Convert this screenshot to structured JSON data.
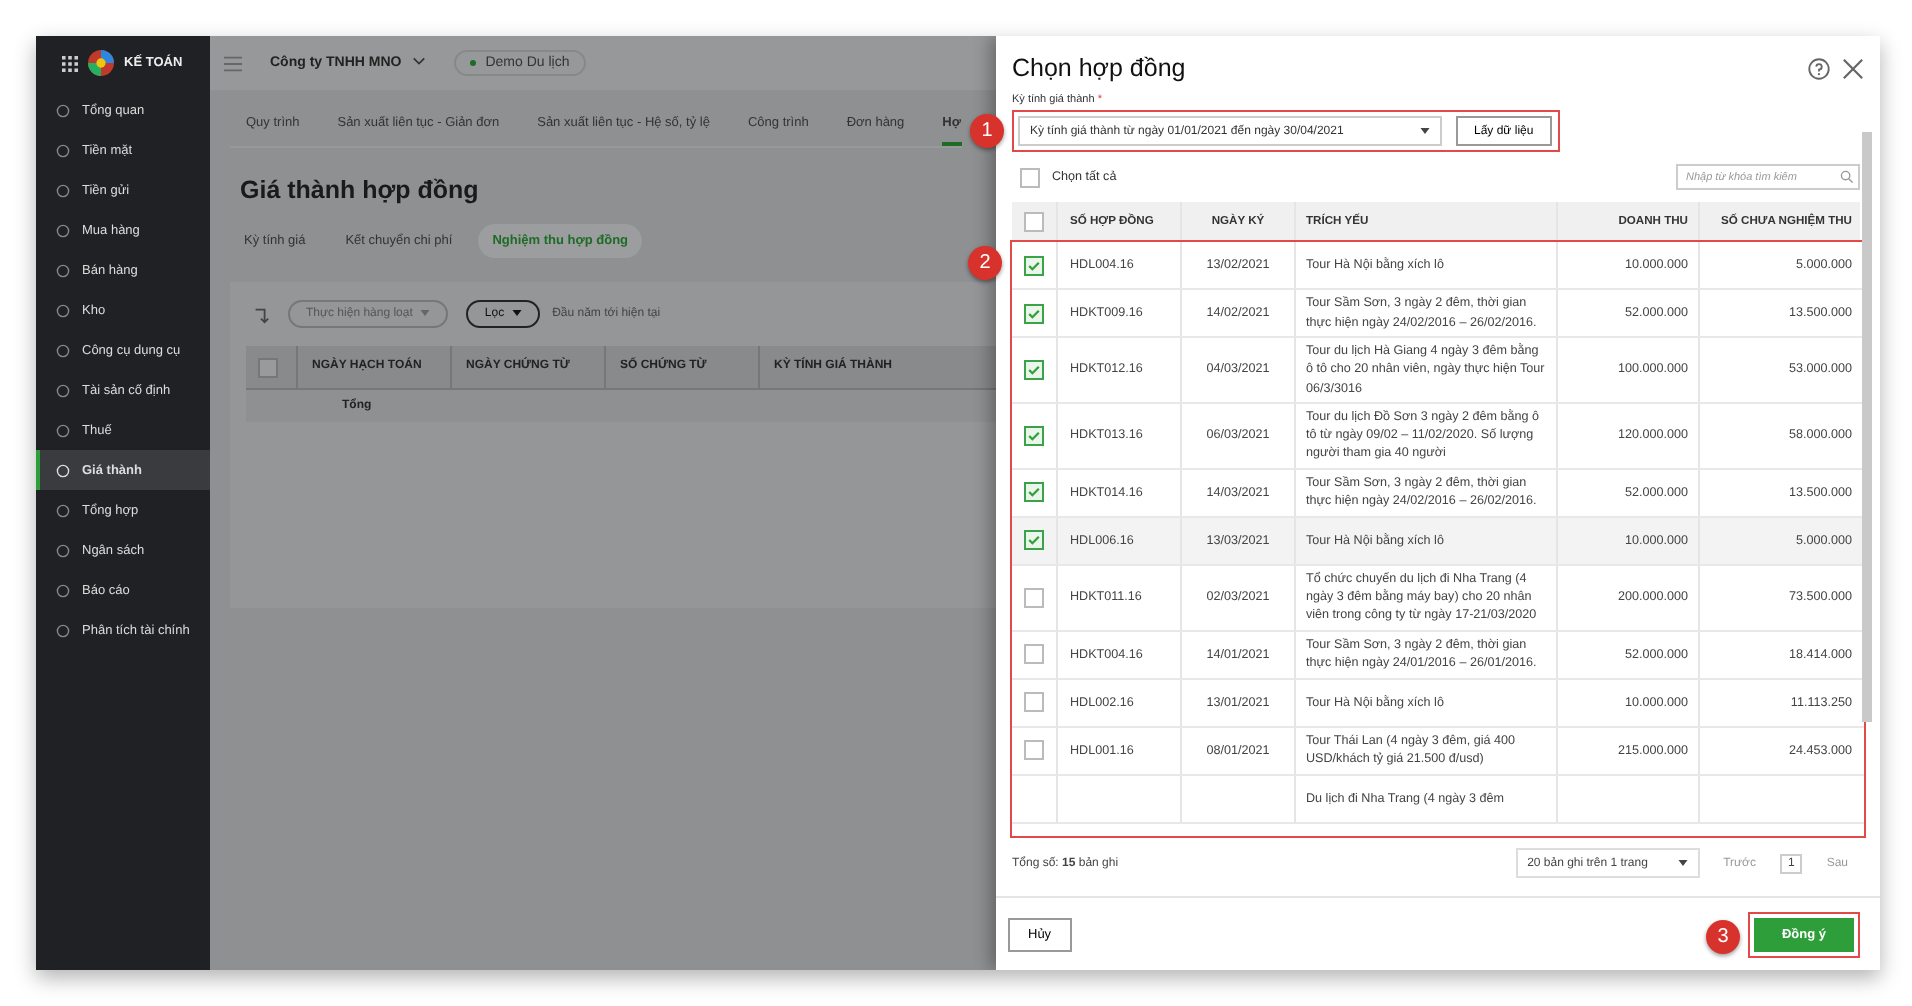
{
  "topbar": {
    "logo": "KẾ TOÁN",
    "company": "Công ty TNHH MNO",
    "database": "Demo Du lịch"
  },
  "sidebar": {
    "items": [
      {
        "label": "Tổng quan",
        "selected": false
      },
      {
        "label": "Tiền mặt",
        "selected": false
      },
      {
        "label": "Tiền gửi",
        "selected": false
      },
      {
        "label": "Mua hàng",
        "selected": false
      },
      {
        "label": "Bán hàng",
        "selected": false
      },
      {
        "label": "Kho",
        "selected": false
      },
      {
        "label": "Công cụ dụng cụ",
        "selected": false
      },
      {
        "label": "Tài sản cố định",
        "selected": false
      },
      {
        "label": "Thuế",
        "selected": false
      },
      {
        "label": "Giá thành",
        "selected": true
      },
      {
        "label": "Tổng hợp",
        "selected": false
      },
      {
        "label": "Ngân sách",
        "selected": false
      },
      {
        "label": "Báo cáo",
        "selected": false
      },
      {
        "label": "Phân tích tài chính",
        "selected": false
      }
    ]
  },
  "main": {
    "tabs": [
      {
        "label": "Quy trình",
        "selected": false
      },
      {
        "label": "Sản xuất liên tục - Giản đơn",
        "selected": false
      },
      {
        "label": "Sản xuất liên tục - Hệ số, tỷ lệ",
        "selected": false
      },
      {
        "label": "Công trình",
        "selected": false
      },
      {
        "label": "Đơn hàng",
        "selected": false
      },
      {
        "label": "Hợ",
        "selected": true
      }
    ],
    "title": "Giá thành hợp đồng",
    "subtabs": [
      {
        "label": "Kỳ tính giá",
        "selected": false
      },
      {
        "label": "Kết chuyển chi phí",
        "selected": false
      },
      {
        "label": "Nghiệm thu hợp đồng",
        "selected": true
      }
    ],
    "bulk_action": "Thực hiện hàng loạt",
    "filter": "Lọc",
    "period": "Đầu năm tới hiện tại",
    "table": {
      "select_all_checked": false,
      "columns": [
        "NGÀY HẠCH TOÁN",
        "NGÀY CHỨNG TỪ",
        "SỐ CHỨNG TỪ",
        "KỲ TÍNH GIÁ THÀNH"
      ],
      "total_label": "Tổng"
    }
  },
  "dialog": {
    "title": "Chọn hợp đồng",
    "period_field": {
      "label": "Kỳ tính giá thành",
      "required_mark": "*",
      "value": "Kỳ tính giá thành từ ngày 01/01/2021 đến ngày 30/04/2021",
      "button": "Lấy dữ liệu",
      "callout": "1"
    },
    "select_all": {
      "label": "Chọn tất cả",
      "checked": false
    },
    "search": {
      "placeholder": "Nhập từ khóa tìm kiếm"
    },
    "table": {
      "callout": "2",
      "header_checked": false,
      "columns": [
        "SỐ HỢP ĐỒNG",
        "NGÀY KÝ",
        "TRÍCH YẾU",
        "DOANH THU",
        "SỐ CHƯA NGHIỆM THU"
      ],
      "rows": [
        {
          "checked": true,
          "number": "HDL004.16",
          "date": "13/02/2021",
          "summary": "Tour Hà Nội bằng xích lô",
          "revenue": "10.000.000",
          "remaining": "5.000.000"
        },
        {
          "checked": true,
          "number": "HDKT009.16",
          "date": "14/02/2021",
          "summary": "Tour Sầm Sơn, 3 ngày 2 đêm, thời gian thực hiện ngày 24/02/2016 – 26/02/2016.",
          "revenue": "52.000.000",
          "remaining": "13.500.000"
        },
        {
          "checked": true,
          "number": "HDKT012.16",
          "date": "04/03/2021",
          "summary": "Tour du lịch Hà Giang 4 ngày 3 đêm bằng ô tô cho 20 nhân viên, ngày thực hiện Tour 06/3/3016",
          "revenue": "100.000.000",
          "remaining": "53.000.000"
        },
        {
          "checked": true,
          "number": "HDKT013.16",
          "date": "06/03/2021",
          "summary": "Tour du lịch Đồ Sơn 3 ngày 2 đêm bằng ô tô từ ngày 09/02 – 11/02/2020. Số lượng người tham gia 40 người",
          "revenue": "120.000.000",
          "remaining": "58.000.000"
        },
        {
          "checked": true,
          "number": "HDKT014.16",
          "date": "14/03/2021",
          "summary": "Tour Sầm Sơn, 3 ngày 2 đêm, thời gian thực hiện ngày 24/02/2016 – 26/02/2016.",
          "revenue": "52.000.000",
          "remaining": "13.500.000"
        },
        {
          "checked": true,
          "number": "HDL006.16",
          "date": "13/03/2021",
          "summary": "Tour Hà Nội bằng xích lô",
          "revenue": "10.000.000",
          "remaining": "5.000.000"
        },
        {
          "checked": false,
          "number": "HDKT011.16",
          "date": "02/03/2021",
          "summary": "Tổ chức chuyến du lịch đi Nha Trang (4 ngày 3 đêm bằng máy bay) cho 20 nhân viên trong công ty từ ngày 17-21/03/2020",
          "revenue": "200.000.000",
          "remaining": "73.500.000"
        },
        {
          "checked": false,
          "number": "HDKT004.16",
          "date": "14/01/2021",
          "summary": "Tour Sầm Sơn, 3 ngày 2 đêm, thời gian thực hiện ngày 24/01/2016 – 26/01/2016.",
          "revenue": "52.000.000",
          "remaining": "18.414.000"
        },
        {
          "checked": false,
          "number": "HDL002.16",
          "date": "13/01/2021",
          "summary": "Tour Hà Nội bằng xích lô",
          "revenue": "10.000.000",
          "remaining": "11.113.250"
        },
        {
          "checked": false,
          "number": "HDL001.16",
          "date": "08/01/2021",
          "summary": "Tour Thái Lan (4 ngày 3 đêm, giá 400 USD/khách tỷ giá 21.500 đ/usd)",
          "revenue": "215.000.000",
          "remaining": "24.453.000"
        },
        {
          "summary": "Du lịch đi Nha Trang (4 ngày 3 đêm"
        }
      ]
    },
    "total": "Tổng số: **15** bản ghi",
    "page_size": "20 bản ghi trên 1 trang",
    "prev": "Trước",
    "page": "1",
    "next": "Sau",
    "cancel": "Hủy",
    "confirm": "Đồng ý",
    "confirm_callout": "3"
  }
}
